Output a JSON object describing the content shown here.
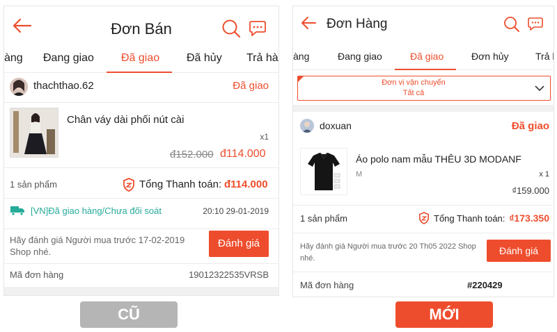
{
  "old": {
    "header": {
      "title": "Đơn Bán"
    },
    "tabs": [
      "àng",
      "Đang giao",
      "Đã giao",
      "Đã hủy",
      "Trả hà"
    ],
    "active_tab": 2,
    "order": {
      "shop": "thachthao.62",
      "status": "Đã giao",
      "product_name": "Chân váy dài phối nút cài",
      "quantity": "x1",
      "original_price": "đ152.000",
      "price": "đ114.000",
      "items_count": "1 sản phẩm",
      "total_label": "Tổng Thanh toán:",
      "total_value": "đ114.000",
      "shipping_status": "[VN]Đã giao hàng/Chưa đối soát",
      "shipping_time": "20:10 29-01-2019",
      "rate_prompt": "Hãy đánh giá Người mua trước 17-02-2019 Shop nhé.",
      "rate_button": "Đánh giá",
      "order_code_label": "Mã đơn hàng",
      "order_code": "19012322535VRSB"
    }
  },
  "new": {
    "header": {
      "title": "Đơn Hàng"
    },
    "tabs": [
      "àng",
      "Đang giao",
      "Đã giao",
      "Đơn hủy",
      "Trả h"
    ],
    "active_tab": 2,
    "filter": {
      "label": "Đơn vị vận chuyển",
      "value": "Tất cả"
    },
    "order": {
      "shop": "doxuan",
      "status": "Đã giao",
      "product_name": "Áo polo nam mẫu THÊU 3D MODANF",
      "variant": "M",
      "quantity": "x 1",
      "price": "₫159.000",
      "items_count": "1 sản phẩm",
      "total_label": "Tổng Thanh toán:",
      "total_value": "₫173.350",
      "rate_prompt": "Hãy đánh giá Người mua trước 20 Th05 2022 Shop nhé.",
      "rate_button": "Đánh giá",
      "order_code_label": "Mã đơn hàng",
      "order_code": "#220429"
    }
  },
  "badges": {
    "old": "CŨ",
    "new": "MỚI"
  },
  "colors": {
    "accent": "#ee4d2d",
    "teal": "#26aa99",
    "badge_old": "#b5b5b5",
    "badge_new": "#ee4d2d"
  }
}
